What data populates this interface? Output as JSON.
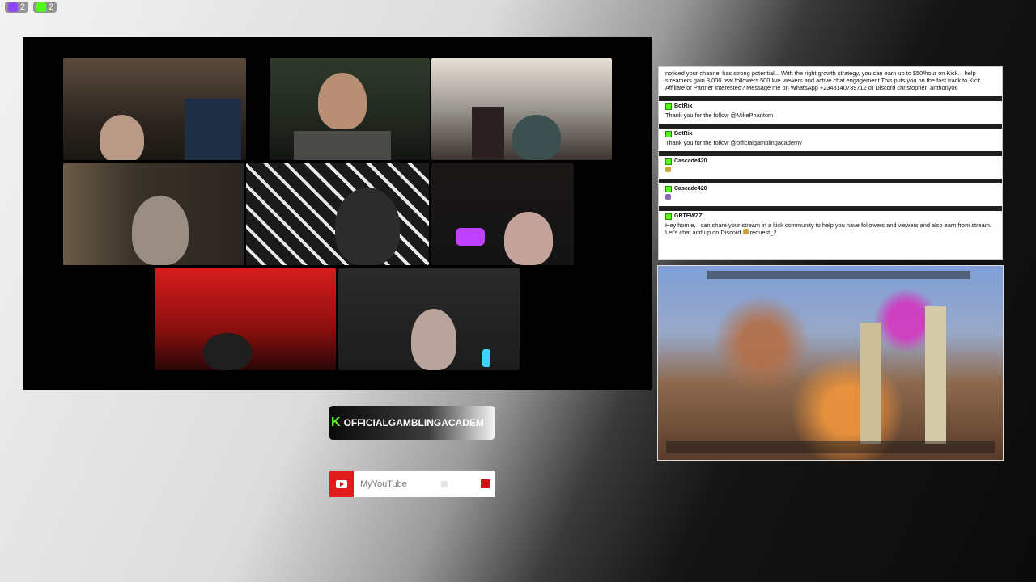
{
  "top_badges": [
    {
      "platform": "twitch",
      "count": "2",
      "color": "#9146ff"
    },
    {
      "platform": "kick",
      "count": "2",
      "color": "#53fc18"
    }
  ],
  "call": {
    "tiles": [
      {
        "name": "cam-1"
      },
      {
        "name": "cam-2"
      },
      {
        "name": "cam-3"
      },
      {
        "name": "cam-4"
      },
      {
        "name": "cam-5"
      },
      {
        "name": "cam-6"
      },
      {
        "name": "cam-7"
      },
      {
        "name": "cam-8"
      }
    ]
  },
  "chat": {
    "messages": [
      {
        "user": "",
        "text": "noticed your channel has strong potential... With the right growth strategy, you can earn up to $50/hour on Kick. I help streamers gain 3,000 real followers 500 live viewers and active chat engagement This puts you on the fast track to Kick Affiliate or Partner Interested? Message me on WhatsApp +2348140739712 or Discord christopher_anthony06"
      },
      {
        "user": "BotRix",
        "text": "Thank you for the follow @MikePhantom"
      },
      {
        "user": "BotRix",
        "text": "Thank you for the follow @officialgamblingacademy"
      },
      {
        "user": "Cascade420",
        "text": ""
      },
      {
        "user": "Cascade420",
        "text": ""
      },
      {
        "user": "GRTEWZZ",
        "text": "Hey homie, I can share your stream in a kick community to help you have followers and viewers and also earn from stream. Let's chat add up on Discord",
        "extra": "request_2"
      }
    ]
  },
  "socials": {
    "kick_name": "OFFICIALGAMBLINGACADEM",
    "youtube_name": "MyYouTube"
  },
  "colors": {
    "kick_green": "#53fc18",
    "youtube_red": "#e01b1b"
  }
}
